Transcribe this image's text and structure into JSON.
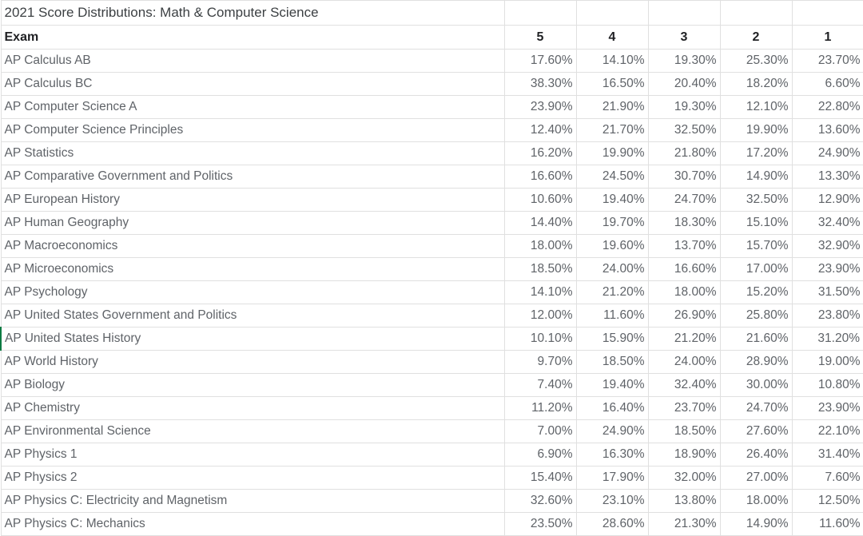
{
  "sheet": {
    "title": "2021 Score Distributions: Math & Computer Science",
    "selected_row_index": 12,
    "accent_color": "#0b7a42",
    "grid_color": "#e0e0e0",
    "text_color": "#5f6368"
  },
  "table": {
    "columns": [
      "Exam",
      "5",
      "4",
      "3",
      "2",
      "1"
    ],
    "rows": [
      {
        "exam": "AP Calculus AB",
        "scores": [
          "17.60%",
          "14.10%",
          "19.30%",
          "25.30%",
          "23.70%"
        ]
      },
      {
        "exam": "AP Calculus BC",
        "scores": [
          "38.30%",
          "16.50%",
          "20.40%",
          "18.20%",
          "6.60%"
        ]
      },
      {
        "exam": "AP Computer Science A",
        "scores": [
          "23.90%",
          "21.90%",
          "19.30%",
          "12.10%",
          "22.80%"
        ]
      },
      {
        "exam": "AP Computer Science Principles",
        "scores": [
          "12.40%",
          "21.70%",
          "32.50%",
          "19.90%",
          "13.60%"
        ]
      },
      {
        "exam": "AP Statistics",
        "scores": [
          "16.20%",
          "19.90%",
          "21.80%",
          "17.20%",
          "24.90%"
        ]
      },
      {
        "exam": "AP Comparative Government and Politics",
        "scores": [
          "16.60%",
          "24.50%",
          "30.70%",
          "14.90%",
          "13.30%"
        ]
      },
      {
        "exam": "AP European History",
        "scores": [
          "10.60%",
          "19.40%",
          "24.70%",
          "32.50%",
          "12.90%"
        ]
      },
      {
        "exam": "AP Human Geography",
        "scores": [
          "14.40%",
          "19.70%",
          "18.30%",
          "15.10%",
          "32.40%"
        ]
      },
      {
        "exam": "AP Macroeconomics",
        "scores": [
          "18.00%",
          "19.60%",
          "13.70%",
          "15.70%",
          "32.90%"
        ]
      },
      {
        "exam": "AP Microeconomics",
        "scores": [
          "18.50%",
          "24.00%",
          "16.60%",
          "17.00%",
          "23.90%"
        ]
      },
      {
        "exam": "AP Psychology",
        "scores": [
          "14.10%",
          "21.20%",
          "18.00%",
          "15.20%",
          "31.50%"
        ]
      },
      {
        "exam": "AP United States Government and Politics",
        "scores": [
          "12.00%",
          "11.60%",
          "26.90%",
          "25.80%",
          "23.80%"
        ]
      },
      {
        "exam": "AP United States History",
        "scores": [
          "10.10%",
          "15.90%",
          "21.20%",
          "21.60%",
          "31.20%"
        ]
      },
      {
        "exam": "AP World History",
        "scores": [
          "9.70%",
          "18.50%",
          "24.00%",
          "28.90%",
          "19.00%"
        ]
      },
      {
        "exam": "AP Biology",
        "scores": [
          "7.40%",
          "19.40%",
          "32.40%",
          "30.00%",
          "10.80%"
        ]
      },
      {
        "exam": "AP Chemistry",
        "scores": [
          "11.20%",
          "16.40%",
          "23.70%",
          "24.70%",
          "23.90%"
        ]
      },
      {
        "exam": "AP Environmental Science",
        "scores": [
          "7.00%",
          "24.90%",
          "18.50%",
          "27.60%",
          "22.10%"
        ]
      },
      {
        "exam": "AP Physics 1",
        "scores": [
          "6.90%",
          "16.30%",
          "18.90%",
          "26.40%",
          "31.40%"
        ]
      },
      {
        "exam": "AP Physics 2",
        "scores": [
          "15.40%",
          "17.90%",
          "32.00%",
          "27.00%",
          "7.60%"
        ]
      },
      {
        "exam": "AP Physics C: Electricity and Magnetism",
        "scores": [
          "32.60%",
          "23.10%",
          "13.80%",
          "18.00%",
          "12.50%"
        ]
      },
      {
        "exam": "AP Physics C: Mechanics",
        "scores": [
          "23.50%",
          "28.60%",
          "21.30%",
          "14.90%",
          "11.60%"
        ]
      }
    ]
  }
}
